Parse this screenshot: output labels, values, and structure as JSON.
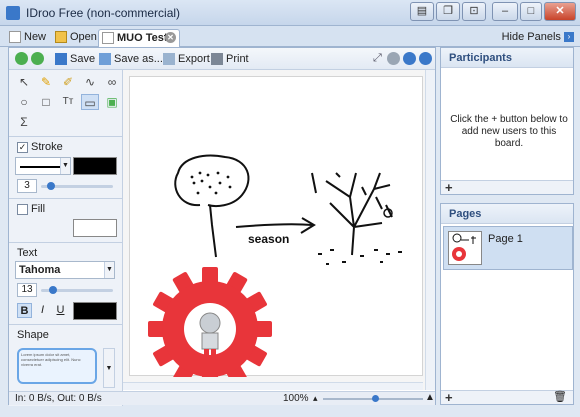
{
  "window": {
    "title": "IDroo Free (non-commercial)"
  },
  "tabs": {
    "new_label": "New",
    "open_label": "Open",
    "active_label": "MUO Test",
    "hide_panels_label": "Hide Panels"
  },
  "toolbar": {
    "save_label": "Save",
    "save_as_label": "Save as...",
    "export_label": "Export",
    "print_label": "Print"
  },
  "tools": {
    "stroke_label": "Stroke",
    "stroke_width": "3",
    "fill_label": "Fill",
    "text_label": "Text",
    "font_name": "Tahoma",
    "font_size": "13",
    "bold_label": "B",
    "italic_label": "I",
    "underline_label": "U",
    "shape_label": "Shape",
    "shape_preview_text": "Lorem ipsum dolor sit amet, consectetuer adipiscing elit. Nunc viverra erat."
  },
  "canvas": {
    "annotation_text": "season"
  },
  "status": {
    "transfer": "In: 0 B/s, Out: 0 B/s",
    "zoom": "100%"
  },
  "participants": {
    "title": "Participants",
    "message": "Click the + button below to add new users to this board."
  },
  "pages": {
    "title": "Pages",
    "items": [
      {
        "label": "Page 1"
      }
    ]
  },
  "colors": {
    "accent": "#3a78c9",
    "gear_red": "#e8353a"
  }
}
